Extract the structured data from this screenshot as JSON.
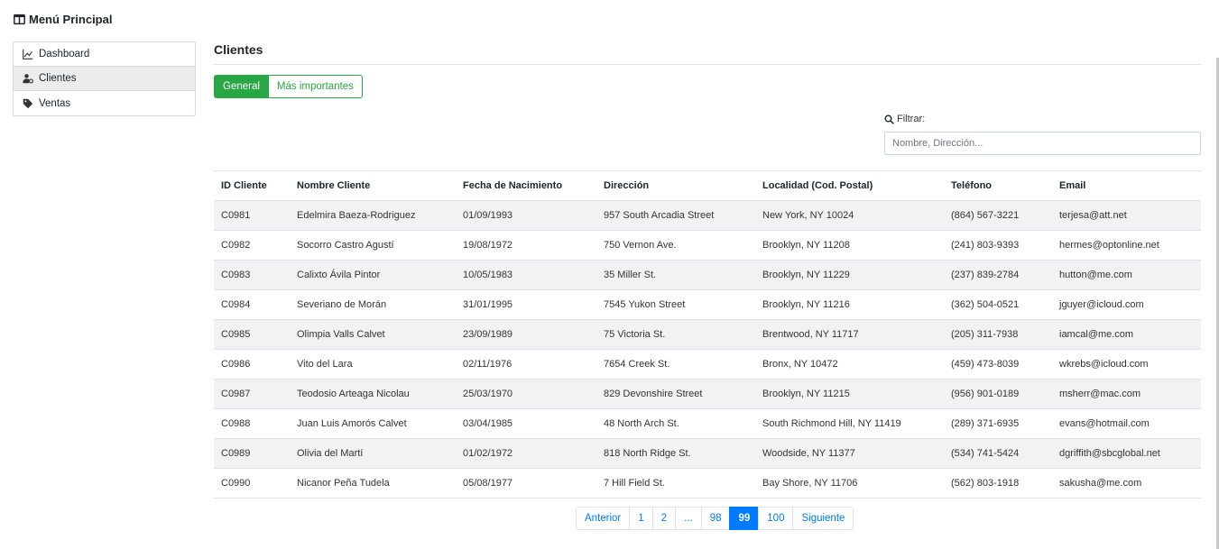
{
  "menu": {
    "title": "Menú Principal",
    "items": [
      {
        "label": "Dashboard",
        "icon": "chart-line-icon",
        "active": false
      },
      {
        "label": "Clientes",
        "icon": "user-cog-icon",
        "active": true
      },
      {
        "label": "Ventas",
        "icon": "tag-icon",
        "active": false
      }
    ]
  },
  "main": {
    "title": "Clientes",
    "tabs": [
      {
        "label": "General",
        "active": true
      },
      {
        "label": "Más importantes",
        "active": false
      }
    ],
    "filter": {
      "label": "Filtrar:",
      "placeholder": "Nombre, Dirección...",
      "value": ""
    }
  },
  "table": {
    "headers": [
      "ID Cliente",
      "Nombre Cliente",
      "Fecha de Nacimiento",
      "Dirección",
      "Localidad (Cod. Postal)",
      "Teléfono",
      "Email"
    ],
    "rows": [
      [
        "C0981",
        "Edelmira Baeza-Rodriguez",
        "01/09/1993",
        "957 South Arcadia Street",
        "New York, NY 10024",
        "(864) 567-3221",
        "terjesa@att.net"
      ],
      [
        "C0982",
        "Socorro Castro Agustí",
        "19/08/1972",
        "750 Vernon Ave.",
        "Brooklyn, NY 11208",
        "(241) 803-9393",
        "hermes@optonline.net"
      ],
      [
        "C0983",
        "Calixto Ávila Pintor",
        "10/05/1983",
        "35 Miller St.",
        "Brooklyn, NY 11229",
        "(237) 839-2784",
        "hutton@me.com"
      ],
      [
        "C0984",
        "Severiano de Morán",
        "31/01/1995",
        "7545 Yukon Street",
        "Brooklyn, NY 11216",
        "(362) 504-0521",
        "jguyer@icloud.com"
      ],
      [
        "C0985",
        "Olimpia Valls Calvet",
        "23/09/1989",
        "75 Victoria St.",
        "Brentwood, NY 11717",
        "(205) 311-7938",
        "iamcal@me.com"
      ],
      [
        "C0986",
        "Vito del Lara",
        "02/11/1976",
        "7654 Creek St.",
        "Bronx, NY 10472",
        "(459) 473-8039",
        "wkrebs@icloud.com"
      ],
      [
        "C0987",
        "Teodosio Arteaga Nicolau",
        "25/03/1970",
        "829 Devonshire Street",
        "Brooklyn, NY 11215",
        "(956) 901-0189",
        "msherr@mac.com"
      ],
      [
        "C0988",
        "Juan Luis Amorós Calvet",
        "03/04/1985",
        "48 North Arch St.",
        "South Richmond Hill, NY 11419",
        "(289) 371-6935",
        "evans@hotmail.com"
      ],
      [
        "C0989",
        "Olivia del Martí",
        "01/02/1972",
        "818 North Ridge St.",
        "Woodside, NY 11377",
        "(534) 741-5424",
        "dgriffith@sbcglobal.net"
      ],
      [
        "C0990",
        "Nicanor Peña Tudela",
        "05/08/1977",
        "7 Hill Field St.",
        "Bay Shore, NY 11706",
        "(562) 803-1918",
        "sakusha@me.com"
      ]
    ]
  },
  "pagination": {
    "items": [
      {
        "label": "Anterior",
        "current": false
      },
      {
        "label": "1",
        "current": false
      },
      {
        "label": "2",
        "current": false
      },
      {
        "label": "...",
        "current": false
      },
      {
        "label": "98",
        "current": false
      },
      {
        "label": "99",
        "current": true
      },
      {
        "label": "100",
        "current": false
      },
      {
        "label": "Siguiente",
        "current": false
      }
    ]
  },
  "colors": {
    "accent_green": "#28a745",
    "link_blue": "#007bff"
  }
}
